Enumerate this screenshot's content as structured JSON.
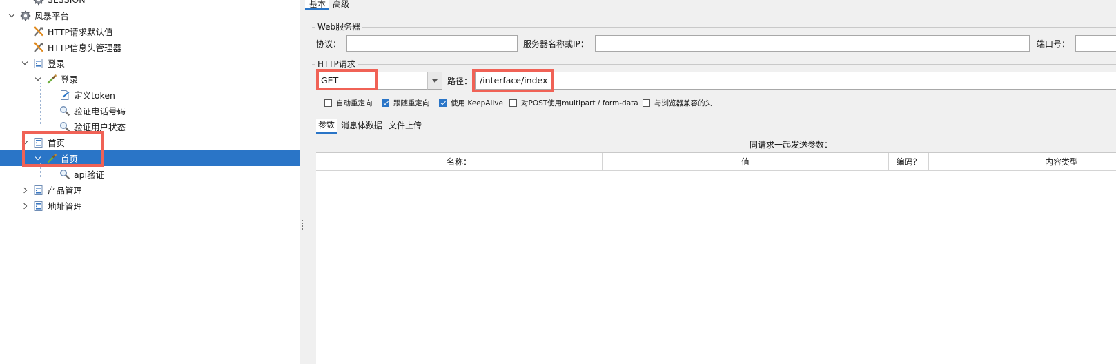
{
  "tree": {
    "items": [
      {
        "label": "SESSION",
        "depth": 1,
        "icon": "gear-icon",
        "expand": "none",
        "selected": false
      },
      {
        "label": "风暴平台",
        "depth": 0,
        "icon": "gear-icon",
        "expand": "down",
        "selected": false
      },
      {
        "label": "HTTP请求默认值",
        "depth": 1,
        "icon": "wrench-icon",
        "expand": "none",
        "selected": false
      },
      {
        "label": "HTTP信息头管理器",
        "depth": 1,
        "icon": "wrench-icon",
        "expand": "none",
        "selected": false
      },
      {
        "label": "登录",
        "depth": 1,
        "icon": "thread-group-icon",
        "expand": "down",
        "selected": false
      },
      {
        "label": "登录",
        "depth": 2,
        "icon": "sampler-pipette-icon",
        "expand": "down",
        "selected": false
      },
      {
        "label": "定义token",
        "depth": 3,
        "icon": "postprocessor-icon",
        "expand": "none",
        "selected": false
      },
      {
        "label": "验证电话号码",
        "depth": 3,
        "icon": "magnifier-icon",
        "expand": "none",
        "selected": false
      },
      {
        "label": "验证用户状态",
        "depth": 3,
        "icon": "magnifier-icon",
        "expand": "none",
        "selected": false
      },
      {
        "label": "首页",
        "depth": 1,
        "icon": "thread-group-icon",
        "expand": "down",
        "selected": false
      },
      {
        "label": "首页",
        "depth": 2,
        "icon": "sampler-pipette-icon",
        "expand": "down",
        "selected": true
      },
      {
        "label": "api验证",
        "depth": 3,
        "icon": "magnifier-icon",
        "expand": "none",
        "selected": false
      },
      {
        "label": "产品管理",
        "depth": 1,
        "icon": "thread-group-icon",
        "expand": "right",
        "selected": false
      },
      {
        "label": "地址管理",
        "depth": 1,
        "icon": "thread-group-icon",
        "expand": "right",
        "selected": false
      }
    ]
  },
  "panel": {
    "tabs": [
      "基本",
      "高级"
    ],
    "web_server": {
      "title": "Web服务器",
      "protocol_label": "协议：",
      "protocol_value": "",
      "server_label": "服务器名称或IP：",
      "server_value": "",
      "port_label": "端口号：",
      "port_value": ""
    },
    "http_request": {
      "title": "HTTP请求",
      "method": "GET",
      "path_label": "路径：",
      "path_value": "/interface/index"
    },
    "options": [
      {
        "label": "自动重定向",
        "checked": false
      },
      {
        "label": "跟随重定向",
        "checked": true
      },
      {
        "label": "使用 KeepAlive",
        "checked": true
      },
      {
        "label": "对POST使用multipart / form-data",
        "checked": false
      },
      {
        "label": "与浏览器兼容的头",
        "checked": false
      }
    ],
    "sub_tabs": [
      "参数",
      "消息体数据",
      "文件上传"
    ],
    "params": {
      "caption": "同请求一起发送参数：",
      "columns": [
        "名称：",
        "值",
        "编码？",
        "内容类型"
      ]
    }
  },
  "colors": {
    "selection": "#2a75c7",
    "highlight_box": "#f06256"
  }
}
